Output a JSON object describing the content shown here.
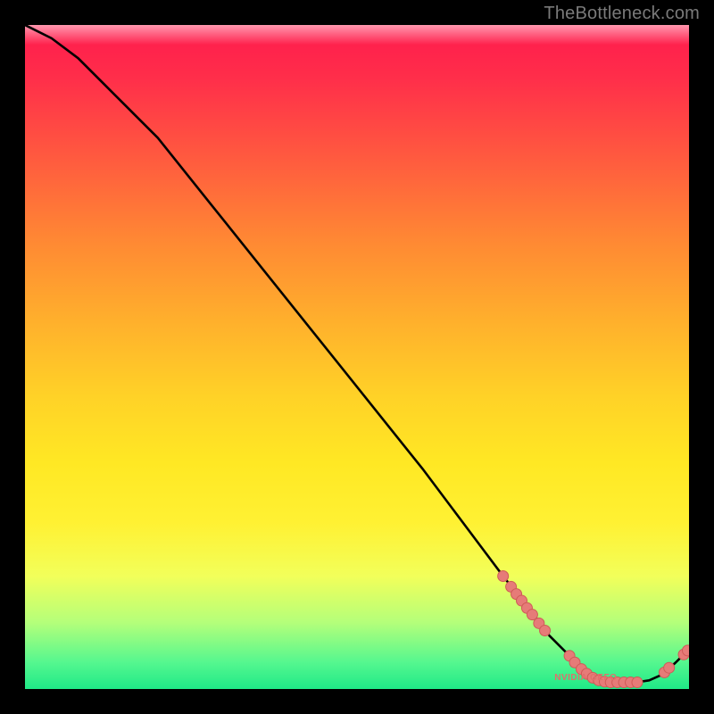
{
  "watermark": "TheBottleneck.com",
  "chart_data": {
    "type": "line",
    "title": "",
    "xlabel": "",
    "ylabel": "",
    "xlim": [
      0,
      100
    ],
    "ylim": [
      0,
      100
    ],
    "grid": false,
    "curve": {
      "x": [
        0,
        4,
        8,
        12,
        16,
        20,
        28,
        36,
        44,
        52,
        60,
        66,
        72,
        76,
        79,
        82,
        84,
        86,
        88,
        90,
        92,
        94,
        96,
        98,
        100
      ],
      "y": [
        100,
        98,
        95,
        91,
        87,
        83,
        73,
        63,
        53,
        43,
        33,
        25,
        17,
        12,
        8,
        5,
        3,
        2,
        1.2,
        1.0,
        1.0,
        1.3,
        2.2,
        4.0,
        6.0
      ]
    },
    "series_points": [
      {
        "name": "cluster-left",
        "label": "",
        "label_xy": null,
        "points": [
          [
            72.0,
            17.0
          ],
          [
            73.2,
            15.4
          ],
          [
            74.0,
            14.3
          ],
          [
            74.8,
            13.3
          ],
          [
            75.6,
            12.2
          ],
          [
            76.4,
            11.2
          ],
          [
            77.4,
            9.9
          ],
          [
            78.3,
            8.8
          ]
        ]
      },
      {
        "name": "cluster-floor",
        "label": "NVIDIA GEFO",
        "label_xy": [
          83.5,
          1.6
        ],
        "points": [
          [
            82.0,
            5.0
          ],
          [
            82.8,
            4.0
          ],
          [
            83.8,
            3.0
          ],
          [
            84.6,
            2.3
          ],
          [
            85.5,
            1.7
          ],
          [
            86.4,
            1.3
          ],
          [
            87.3,
            1.1
          ],
          [
            88.2,
            1.0
          ],
          [
            89.2,
            1.0
          ],
          [
            90.2,
            1.0
          ],
          [
            91.2,
            1.0
          ],
          [
            92.2,
            1.0
          ]
        ]
      },
      {
        "name": "cluster-right",
        "label": "",
        "label_xy": null,
        "points": [
          [
            96.3,
            2.5
          ],
          [
            97.0,
            3.2
          ],
          [
            99.2,
            5.2
          ],
          [
            99.8,
            5.8
          ]
        ]
      }
    ],
    "colors": {
      "curve": "#000000",
      "point_fill": "#e67b78",
      "point_stroke": "#cf5a57"
    }
  }
}
